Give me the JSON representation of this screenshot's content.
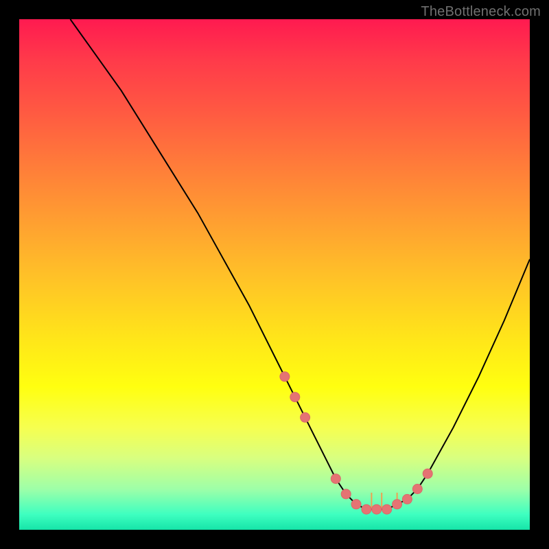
{
  "watermark": "TheBottleneck.com",
  "colors": {
    "background": "#000000",
    "curve": "#000000",
    "marker_fill": "#e57373",
    "marker_stroke": "#d86a6a",
    "tick_stroke": "#f0a050"
  },
  "chart_data": {
    "type": "line",
    "title": "",
    "xlabel": "",
    "ylabel": "",
    "xlim": [
      0,
      100
    ],
    "ylim": [
      0,
      100
    ],
    "series": [
      {
        "name": "bottleneck-curve",
        "x": [
          10,
          15,
          20,
          25,
          30,
          35,
          40,
          45,
          50,
          52,
          54,
          56,
          58,
          60,
          62,
          64,
          66,
          68,
          70,
          72,
          74,
          76,
          78,
          80,
          85,
          90,
          95,
          100
        ],
        "y": [
          100,
          93,
          86,
          78,
          70,
          62,
          53,
          44,
          34,
          30,
          26,
          22,
          18,
          14,
          10,
          7,
          5,
          4,
          4,
          4,
          5,
          6,
          8,
          11,
          20,
          30,
          41,
          53
        ]
      }
    ],
    "markers": {
      "name": "highlight-points",
      "x": [
        52,
        54,
        56,
        62,
        64,
        66,
        68,
        70,
        72,
        74,
        76,
        78,
        80
      ],
      "y": [
        30,
        26,
        22,
        10,
        7,
        5,
        4,
        4,
        4,
        5,
        6,
        8,
        11
      ]
    },
    "ticks": {
      "x": [
        69,
        71,
        74
      ],
      "y_bottom": 4,
      "height": 3
    }
  }
}
